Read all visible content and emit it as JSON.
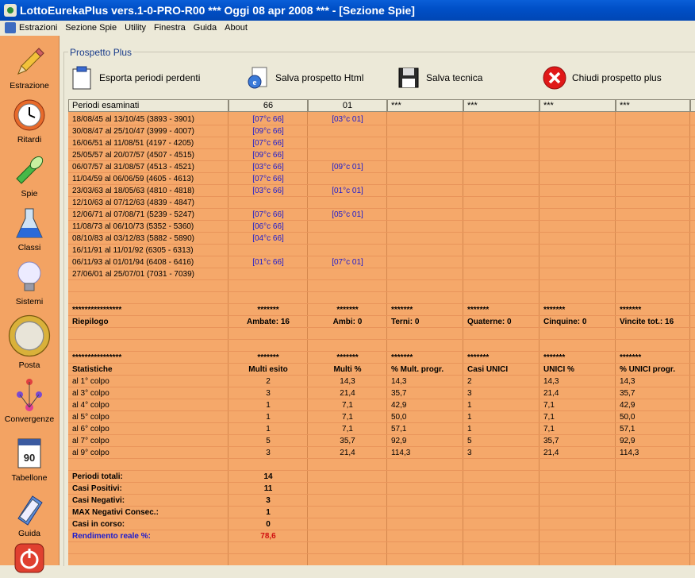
{
  "window": {
    "title": "LottoEurekaPlus vers.1-0-PRO-R00  ***  Oggi 08 apr 2008  ***   - [Sezione Spie]"
  },
  "menu": [
    "Estrazioni",
    "Sezione Spie",
    "Utility",
    "Finestra",
    "Guida",
    "About"
  ],
  "sidebar": [
    {
      "label": "Estrazione",
      "icon": "pencil-icon"
    },
    {
      "label": "Ritardi",
      "icon": "clock-icon"
    },
    {
      "label": "Spie",
      "icon": "flashlight-icon"
    },
    {
      "label": "Classi",
      "icon": "flask-icon"
    },
    {
      "label": "Sistemi",
      "icon": "lightbulb-icon"
    },
    {
      "label": "Posta",
      "icon": "coin-icon"
    },
    {
      "label": "Convergenze",
      "icon": "convergence-icon"
    },
    {
      "label": "Tabellone",
      "icon": "calendar-icon"
    },
    {
      "label": "Guida",
      "icon": "book-icon"
    },
    {
      "label": "",
      "icon": "power-icon"
    }
  ],
  "panel": {
    "title": "Prospetto Plus"
  },
  "toolbar": {
    "export": "Esporta periodi perdenti",
    "save_html": "Salva prospetto Html",
    "save_tech": "Salva tecnica",
    "close": "Chiudi prospetto plus"
  },
  "headers": [
    "Periodi esaminati",
    "66",
    "01",
    "***",
    "***",
    "***",
    "***"
  ],
  "periods": [
    {
      "p": "18/08/45 al 13/10/45  (3893 - 3901)",
      "a": "[07°c 66]",
      "b": "[03°c 01]"
    },
    {
      "p": "30/08/47 al 25/10/47  (3999 - 4007)",
      "a": "[09°c 66]",
      "b": ""
    },
    {
      "p": "16/06/51 al 11/08/51  (4197 - 4205)",
      "a": "[07°c 66]",
      "b": ""
    },
    {
      "p": "25/05/57 al 20/07/57  (4507 - 4515)",
      "a": "[09°c 66]",
      "b": ""
    },
    {
      "p": "06/07/57 al 31/08/57  (4513 - 4521)",
      "a": "[03°c 66]",
      "b": "[09°c 01]"
    },
    {
      "p": "11/04/59 al 06/06/59  (4605 - 4613)",
      "a": "[07°c 66]",
      "b": ""
    },
    {
      "p": "23/03/63 al 18/05/63  (4810 - 4818)",
      "a": "[03°c 66]",
      "b": "[01°c 01]"
    },
    {
      "p": "12/10/63 al 07/12/63  (4839 - 4847)",
      "a": "",
      "b": ""
    },
    {
      "p": "12/06/71 al 07/08/71  (5239 - 5247)",
      "a": "[07°c 66]",
      "b": "[05°c 01]"
    },
    {
      "p": "11/08/73 al 06/10/73  (5352 - 5360)",
      "a": "[06°c 66]",
      "b": ""
    },
    {
      "p": "08/10/83 al 03/12/83  (5882 - 5890)",
      "a": "[04°c 66]",
      "b": ""
    },
    {
      "p": "16/11/91 al 11/01/92  (6305 - 6313)",
      "a": "",
      "b": ""
    },
    {
      "p": "06/11/93 al 01/01/94  (6408 - 6416)",
      "a": "[01°c 66]",
      "b": "[07°c 01]"
    },
    {
      "p": "27/06/01 al 25/07/01  (7031 - 7039)",
      "a": "",
      "b": ""
    }
  ],
  "riepilogo": {
    "stars": [
      "****************",
      "*******",
      "*******",
      "*******",
      "*******",
      "*******",
      "*******"
    ],
    "cells": [
      "Riepilogo",
      "Ambate: 16",
      "Ambi: 0",
      "Terni: 0",
      "Quaterne: 0",
      "Cinquine: 0",
      "Vincite tot.: 16"
    ]
  },
  "statistiche": {
    "stars": [
      "****************",
      "*******",
      "*******",
      "*******",
      "*******",
      "*******",
      "*******"
    ],
    "headers": [
      "Statistiche",
      "Multi esito",
      "Multi %",
      "% Mult. progr.",
      "Casi UNICI",
      "UNICI %",
      "% UNICI progr."
    ],
    "rows": [
      [
        "al 1° colpo",
        "2",
        "14,3",
        "14,3",
        "2",
        "14,3",
        "14,3"
      ],
      [
        "al 3° colpo",
        "3",
        "21,4",
        "35,7",
        "3",
        "21,4",
        "35,7"
      ],
      [
        "al 4° colpo",
        "1",
        "7,1",
        "42,9",
        "1",
        "7,1",
        "42,9"
      ],
      [
        "al 5° colpo",
        "1",
        "7,1",
        "50,0",
        "1",
        "7,1",
        "50,0"
      ],
      [
        "al 6° colpo",
        "1",
        "7,1",
        "57,1",
        "1",
        "7,1",
        "57,1"
      ],
      [
        "al 7° colpo",
        "5",
        "35,7",
        "92,9",
        "5",
        "35,7",
        "92,9"
      ],
      [
        "al 9° colpo",
        "3",
        "21,4",
        "114,3",
        "3",
        "21,4",
        "114,3"
      ]
    ]
  },
  "totals": [
    {
      "label": "Periodi totali:",
      "value": "14"
    },
    {
      "label": "Casi Positivi:",
      "value": "11"
    },
    {
      "label": "Casi Negativi:",
      "value": "3"
    },
    {
      "label": "MAX Negativi Consec.:",
      "value": "1"
    },
    {
      "label": "Casi in corso:",
      "value": "0"
    },
    {
      "label": "Rendimento reale %:",
      "value": "78,6"
    }
  ]
}
